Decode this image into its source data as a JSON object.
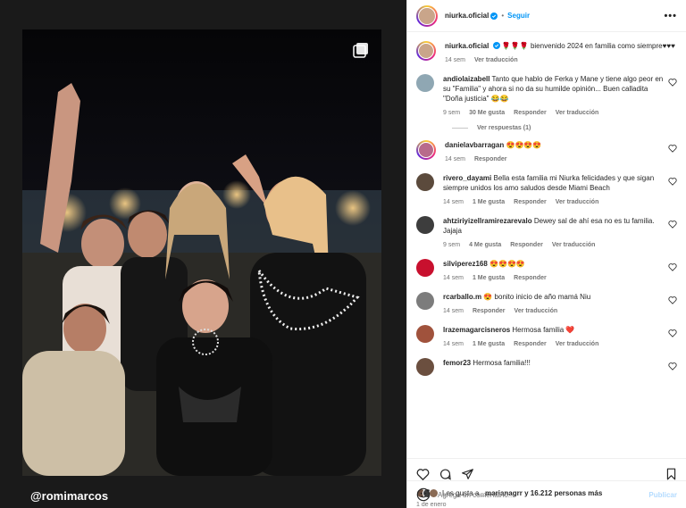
{
  "post": {
    "author": "niurka.oficial",
    "follow_label": "Seguir",
    "more_label": "•••",
    "watermark": "@romimarcos",
    "caption": {
      "user": "niurka.oficial",
      "emoji": "🌹🌹🌹",
      "text": "bienvenido 2024 en familia como siempre♥♥♥",
      "time": "14 sem",
      "translate": "Ver traducción"
    }
  },
  "comments": [
    {
      "user": "andiolaizabell",
      "text": "Tanto que hablo de Ferka y Mane y tiene algo peor en su \"Familia\" y ahora si no da su humilde opinión... Buen calladita \"Doña justicia\" 😂😂",
      "time": "9 sem",
      "likes": "30 Me gusta",
      "reply": "Responder",
      "translate": "Ver traducción",
      "avatar_color": "#8fa7b3",
      "ring": false,
      "replies_label": "Ver respuestas (1)"
    },
    {
      "user": "danielavbarragan",
      "text": "😍😍😍😍",
      "time": "14 sem",
      "likes": "",
      "reply": "Responder",
      "translate": "",
      "avatar_color": "#b86b8b",
      "ring": true
    },
    {
      "user": "rivero_dayami",
      "text": "Bella esta familia mi Niurka felicidades y que sigan siempre unidos los amo saludos desde Miami Beach",
      "time": "14 sem",
      "likes": "1 Me gusta",
      "reply": "Responder",
      "translate": "Ver traducción",
      "avatar_color": "#5b4a3c",
      "ring": false
    },
    {
      "user": "ahtziriyizellramirezarevalo",
      "text": "Dewey sal de ahí esa no es tu familia. Jajaja",
      "time": "9 sem",
      "likes": "4 Me gusta",
      "reply": "Responder",
      "translate": "Ver traducción",
      "avatar_color": "#3d3d3d",
      "ring": false
    },
    {
      "user": "silviperez168",
      "text": "😍😍😍😍",
      "time": "14 sem",
      "likes": "1 Me gusta",
      "reply": "Responder",
      "translate": "",
      "avatar_color": "#c8102e",
      "ring": false
    },
    {
      "user": "rcarballo.m",
      "text": "😍 bonito inicio de año mamá Niu",
      "time": "14 sem",
      "likes": "",
      "reply": "Responder",
      "translate": "Ver traducción",
      "avatar_color": "#7c7c7c",
      "ring": false
    },
    {
      "user": "lrazemagarcisneros",
      "text": "Hermosa familia ❤️",
      "time": "14 sem",
      "likes": "1 Me gusta",
      "reply": "Responder",
      "translate": "Ver traducción",
      "avatar_color": "#a0523c",
      "ring": false
    },
    {
      "user": "femor23",
      "text": "Hermosa familia!!!",
      "time": "",
      "likes": "",
      "reply": "",
      "translate": "",
      "avatar_color": "#6b4f3f",
      "ring": false
    }
  ],
  "likes": {
    "prefix": "Les gusta a",
    "user": "_marianagrr",
    "suffix": "y 16.212 personas más",
    "date": "1 de enero"
  },
  "add_comment": {
    "placeholder": "Agrega un comentario...",
    "post_label": "Publicar"
  },
  "colors": {
    "accent": "#0095f6",
    "verified": "#0095f6",
    "muted": "#737373"
  },
  "icons": [
    "heart-icon",
    "comment-icon",
    "share-icon",
    "bookmark-icon",
    "emoji-icon",
    "carousel-icon",
    "verified-icon",
    "more-icon"
  ]
}
